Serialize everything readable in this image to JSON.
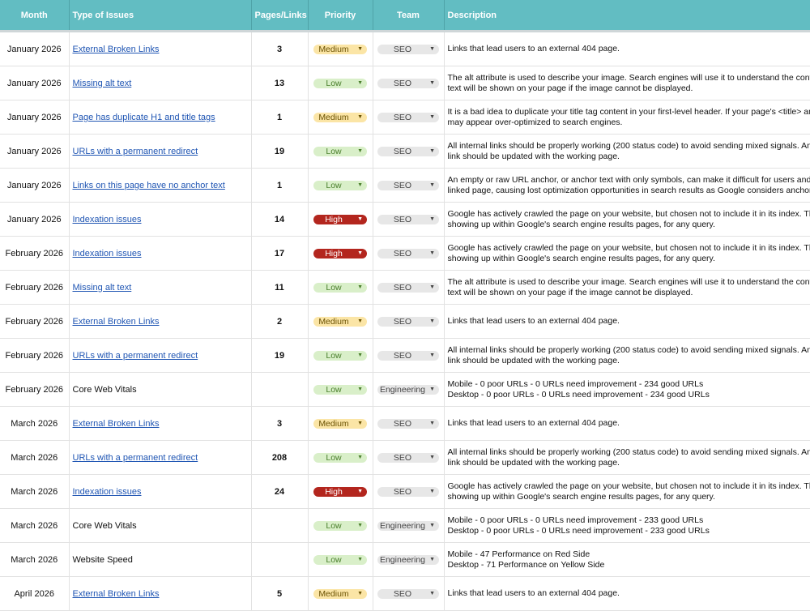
{
  "colors": {
    "header_bg": "#62bdc2",
    "link": "#1f55b3",
    "high": "#b3261e",
    "medium": "#fbe5a6",
    "low": "#d9efc9"
  },
  "headers": {
    "month": "Month",
    "type": "Type of Issues",
    "pages": "Pages/Links",
    "priority": "Priority",
    "team": "Team",
    "description": "Description"
  },
  "rows": [
    {
      "month": "January 2026",
      "type": "External Broken Links",
      "link": true,
      "pages": "3",
      "priority": "Medium",
      "team": "SEO",
      "desc": [
        "Links that lead users to an external 404 page."
      ]
    },
    {
      "month": "January 2026",
      "type": "Missing alt text",
      "link": true,
      "pages": "13",
      "priority": "Low",
      "team": "SEO",
      "desc": [
        "The alt attribute is used to describe your image. Search engines will use it to understand the conte",
        "text will be shown on your page if the image cannot be displayed."
      ]
    },
    {
      "month": "January 2026",
      "type": "Page has duplicate H1 and title tags",
      "link": true,
      "pages": "1",
      "priority": "Medium",
      "team": "SEO",
      "desc": [
        "It is a bad idea to duplicate your title tag content in your first-level header. If your page's <title> an",
        "may appear over-optimized to search engines."
      ]
    },
    {
      "month": "January 2026",
      "type": "URLs with a permanent redirect",
      "link": true,
      "pages": "19",
      "priority": "Low",
      "team": "SEO",
      "desc": [
        "All internal links should be properly working (200 status code) to avoid sending mixed signals. Any",
        "link should be updated with the working page."
      ]
    },
    {
      "month": "January 2026",
      "type": "Links on this page have no anchor text",
      "link": true,
      "pages": "1",
      "priority": "Low",
      "team": "SEO",
      "desc": [
        "An empty or raw URL anchor, or anchor text with only symbols, can make it difficult for users and c",
        "linked page, causing lost optimization opportunities in search results as Google considers anchor t"
      ]
    },
    {
      "month": "January 2026",
      "type": "Indexation issues",
      "link": true,
      "pages": "14",
      "priority": "High",
      "team": "SEO",
      "desc": [
        "Google has actively crawled the page on your website, but chosen not to include it in its index. This",
        "showing up within Google's search engine results pages, for any query."
      ]
    },
    {
      "month": "February 2026",
      "type": "Indexation issues",
      "link": true,
      "pages": "17",
      "priority": "High",
      "team": "SEO",
      "desc": [
        "Google has actively crawled the page on your website, but chosen not to include it in its index. This",
        "showing up within Google's search engine results pages, for any query."
      ]
    },
    {
      "month": "February 2026",
      "type": "Missing alt text",
      "link": true,
      "pages": "11",
      "priority": "Low",
      "team": "SEO",
      "desc": [
        "The alt attribute is used to describe your image. Search engines will use it to understand the conte",
        "text will be shown on your page if the image cannot be displayed."
      ]
    },
    {
      "month": "February 2026",
      "type": "External Broken Links",
      "link": true,
      "pages": "2",
      "priority": "Medium",
      "team": "SEO",
      "desc": [
        "Links that lead users to an external 404 page."
      ]
    },
    {
      "month": "February 2026",
      "type": "URLs with a permanent redirect",
      "link": true,
      "pages": "19",
      "priority": "Low",
      "team": "SEO",
      "desc": [
        "All internal links should be properly working (200 status code) to avoid sending mixed signals. Any",
        "link should be updated with the working page."
      ]
    },
    {
      "month": "February 2026",
      "type": "Core Web Vitals",
      "link": false,
      "pages": "",
      "priority": "Low",
      "team": "Engineering",
      "desc": [
        "Mobile - 0 poor URLs - 0 URLs need improvement - 234 good URLs",
        "Desktop - 0 poor URLs - 0 URLs need improvement - 234 good URLs"
      ]
    },
    {
      "month": "March 2026",
      "type": "External Broken Links",
      "link": true,
      "pages": "3",
      "priority": "Medium",
      "team": "SEO",
      "desc": [
        "Links that lead users to an external 404 page."
      ]
    },
    {
      "month": "March 2026",
      "type": "URLs with a permanent redirect",
      "link": true,
      "pages": "208",
      "priority": "Low",
      "team": "SEO",
      "desc": [
        "All internal links should be properly working (200 status code) to avoid sending mixed signals. Any",
        "link should be updated with the working page."
      ]
    },
    {
      "month": "March 2026",
      "type": "Indexation issues",
      "link": true,
      "pages": "24",
      "priority": "High",
      "team": "SEO",
      "desc": [
        "Google has actively crawled the page on your website, but chosen not to include it in its index. This",
        "showing up within Google's search engine results pages, for any query."
      ]
    },
    {
      "month": "March 2026",
      "type": "Core Web Vitals",
      "link": false,
      "pages": "",
      "priority": "Low",
      "team": "Engineering",
      "desc": [
        "Mobile - 0 poor URLs - 0 URLs need improvement - 233 good URLs",
        "Desktop - 0 poor URLs - 0 URLs need improvement - 233 good URLs"
      ]
    },
    {
      "month": "March 2026",
      "type": "Website Speed",
      "link": false,
      "pages": "",
      "priority": "Low",
      "team": "Engineering",
      "desc": [
        "Mobile - 47 Performance on Red Side",
        "Desktop - 71 Performance on Yellow Side"
      ]
    },
    {
      "month": "April 2026",
      "type": "External Broken Links",
      "link": true,
      "pages": "5",
      "priority": "Medium",
      "team": "SEO",
      "desc": [
        "Links that lead users to an external 404 page."
      ]
    }
  ]
}
